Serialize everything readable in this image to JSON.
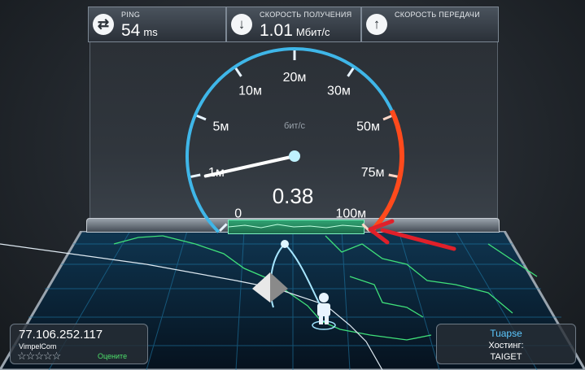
{
  "stats": {
    "ping": {
      "label": "PING",
      "value": "54",
      "unit": "ms",
      "icon": "exchange-icon"
    },
    "download": {
      "label": "СКОРОСТЬ ПОЛУЧЕНИЯ",
      "value": "1.01",
      "unit": "Мбит/с",
      "icon": "download-arrow-icon"
    },
    "upload": {
      "label": "СКОРОСТЬ ПЕРЕДАЧИ",
      "value": "",
      "unit": "",
      "icon": "upload-arrow-icon"
    }
  },
  "gauge": {
    "unit_label": "бит/с",
    "current_value": "0.38",
    "scale": [
      "0",
      "1м",
      "5м",
      "10м",
      "20м",
      "30м",
      "50м",
      "75м",
      "100м"
    ],
    "needle_fraction": 0.12,
    "colors": {
      "arc": "#3fb6e8",
      "high": "#ff4a1c",
      "needle": "#ffffff"
    }
  },
  "client": {
    "ip": "77.106.252.117",
    "isp": "VimpelCom",
    "rating_stars": 5,
    "rate_label": "Оцените"
  },
  "server": {
    "city": "Tuapse",
    "host_label": "Хостинг:",
    "host_name": "TAIGET"
  },
  "annotation": {
    "arrow_color": "#e0202a"
  }
}
